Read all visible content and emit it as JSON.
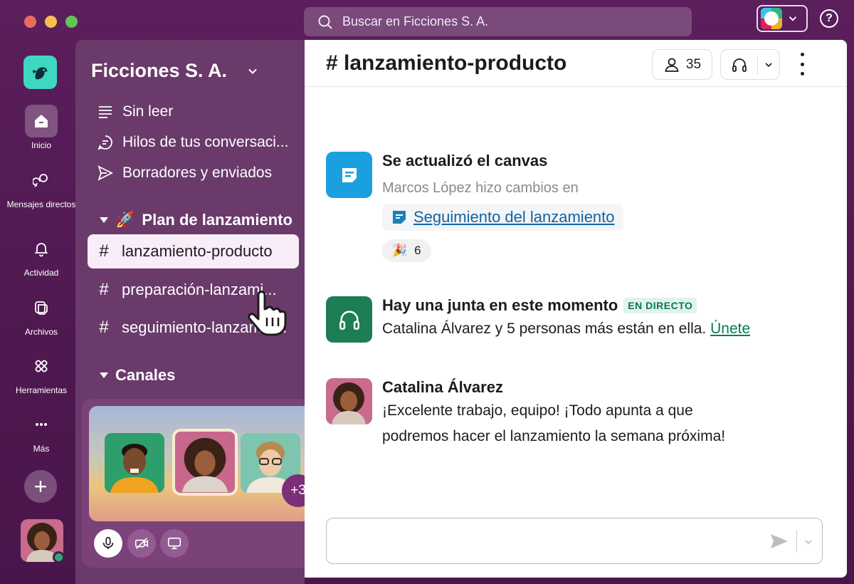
{
  "search": {
    "placeholder": "Buscar en Ficciones S. A."
  },
  "help": {
    "label": "?"
  },
  "rail": {
    "items": [
      {
        "label": "Inicio",
        "icon": "home-icon"
      },
      {
        "label": "Mensajes directos",
        "icon": "dm-icon"
      },
      {
        "label": "Actividad",
        "icon": "bell-icon"
      },
      {
        "label": "Archivos",
        "icon": "files-icon"
      },
      {
        "label": "Herramientas",
        "icon": "tools-icon"
      },
      {
        "label": "Más",
        "icon": "more-icon"
      }
    ],
    "add_label": "+"
  },
  "sidebar": {
    "workspace": "Ficciones S. A.",
    "nav": [
      {
        "label": "Sin leer",
        "icon": "list-icon"
      },
      {
        "label": "Hilos de tus conversaci...",
        "icon": "threads-icon"
      },
      {
        "label": "Borradores y enviados",
        "icon": "send-icon"
      }
    ],
    "section_launch": {
      "emoji": "🚀",
      "label": "Plan de lanzamiento"
    },
    "channels": [
      {
        "hash": "#",
        "label": "lanzamiento-producto",
        "active": true
      },
      {
        "hash": "#",
        "label": "preparación-lanzami...",
        "active": false
      },
      {
        "hash": "#",
        "label": "seguimiento-lanzamie...",
        "active": false
      }
    ],
    "section_channels": {
      "label": "Canales"
    }
  },
  "huddle": {
    "extra_count": "+3"
  },
  "channel": {
    "title": "# lanzamiento-producto",
    "members_count": "35"
  },
  "messages": {
    "canvas": {
      "title": "Se actualizó el canvas",
      "subtitle": "Marcos López hizo cambios en",
      "link": "Seguimiento del lanzamiento",
      "reaction_emoji": "🎉",
      "reaction_count": "6"
    },
    "meeting": {
      "title": "Hay una junta en este momento",
      "badge": "EN DIRECTO",
      "text": "Catalina Álvarez y 5 personas más están en ella.",
      "join": "Únete"
    },
    "catalina": {
      "name": "Catalina Álvarez",
      "line1": "¡Excelente trabajo, equipo! ¡Todo apunta a que",
      "line2": "podremos hacer el lanzamiento la semana próxima!"
    }
  },
  "colors": {
    "aubergine": "#4a154b",
    "sidebar": "#6a3a6b",
    "active_channel": "#f9edf9",
    "link_blue": "#1264a3",
    "live_green": "#007a5a",
    "canvas_icon": "#1ba0df",
    "huddle_icon": "#1d7d55"
  }
}
